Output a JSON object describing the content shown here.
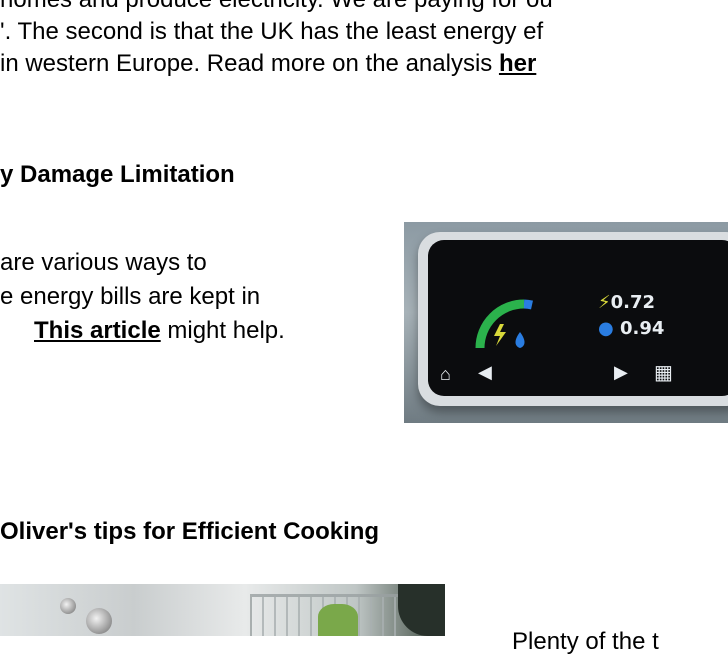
{
  "intro": {
    "line1": "homes and produce electricity. We are paying for ou",
    "line2": "'. The second is that the UK has the least energy ef",
    "line3_text": " in western Europe.  Read more on the analysis ",
    "line3_link": "her"
  },
  "damage": {
    "heading": "y Damage Limitation",
    "line1": "are various ways to",
    "line2": "e energy bills are kept in",
    "line3_link": "This article",
    "line3_text": " might help.",
    "meter": {
      "electric_value": "0.72",
      "gas_value": "0.94",
      "accent_green": "#2bb24c",
      "accent_blue": "#2a7de1",
      "icons": [
        "home-icon",
        "back-arrow-icon",
        "forward-arrow-icon",
        "grid-menu-icon"
      ]
    }
  },
  "cooking": {
    "heading": "Oliver's tips for Efficient Cooking",
    "side_text": "Plenty of the t"
  }
}
